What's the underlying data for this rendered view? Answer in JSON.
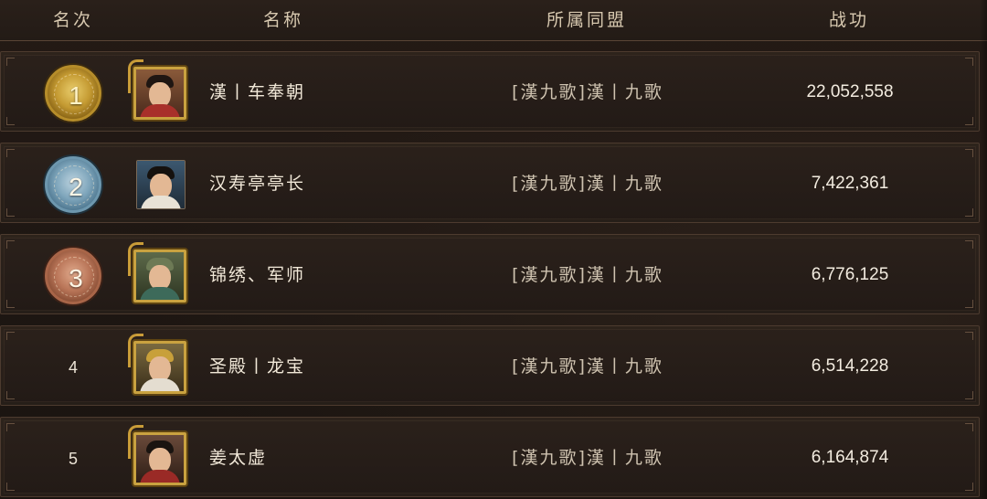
{
  "header": {
    "rank": "名次",
    "name": "名称",
    "alliance": "所属同盟",
    "power": "战功"
  },
  "rows": [
    {
      "rank": "1",
      "medal": "gold",
      "name": "漢丨车奉朝",
      "alliance": "[漢九歌]漢丨九歌",
      "power": "22,052,558",
      "avatar": "framed"
    },
    {
      "rank": "2",
      "medal": "silver",
      "name": "汉寿亭亭长",
      "alliance": "[漢九歌]漢丨九歌",
      "power": "7,422,361",
      "avatar": "plain"
    },
    {
      "rank": "3",
      "medal": "bronze",
      "name": "锦绣、军师",
      "alliance": "[漢九歌]漢丨九歌",
      "power": "6,776,125",
      "avatar": "framed"
    },
    {
      "rank": "4",
      "medal": "none",
      "name": "圣殿丨龙宝",
      "alliance": "[漢九歌]漢丨九歌",
      "power": "6,514,228",
      "avatar": "framed"
    },
    {
      "rank": "5",
      "medal": "none",
      "name": "姜太虚",
      "alliance": "[漢九歌]漢丨九歌",
      "power": "6,164,874",
      "avatar": "framed"
    }
  ],
  "colors": {
    "background": "#1f1814",
    "row_border": "#4d3b2f",
    "gold": "#c49a32",
    "silver": "#7ea5bb",
    "bronze": "#b97558",
    "text": "#f1e8d8"
  }
}
